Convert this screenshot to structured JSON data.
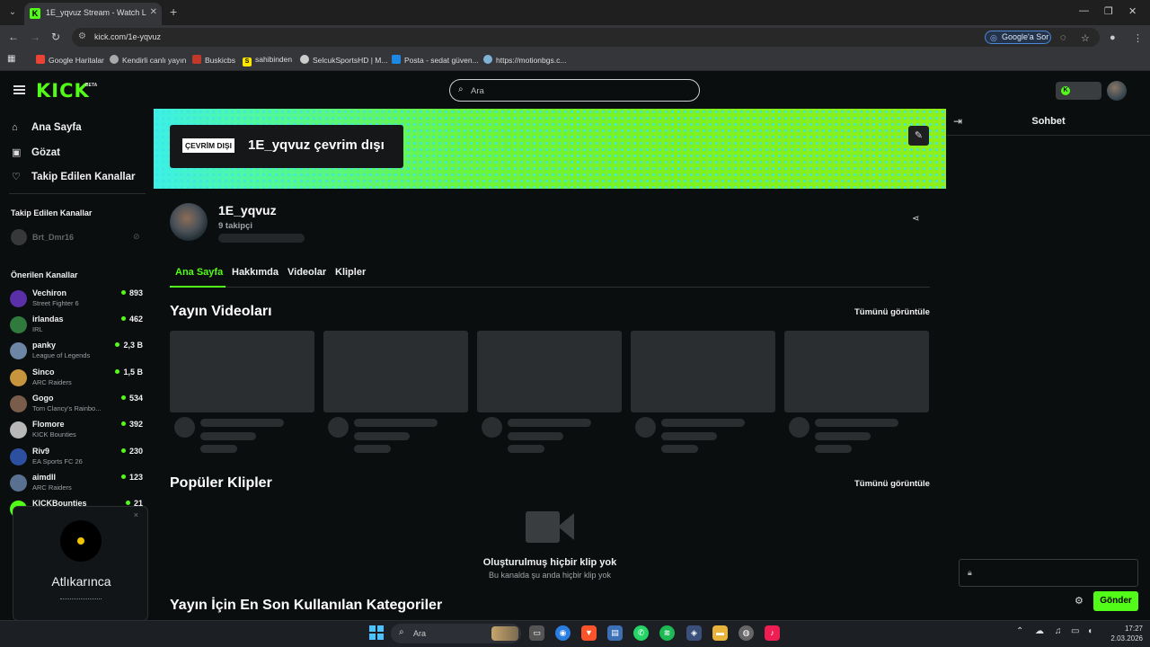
{
  "browser": {
    "tab_title": "1E_yqvuz Stream - Watch Live o",
    "tab_favicon": "K",
    "url": "kick.com/1e-yqvuz",
    "google_sor": "Google'a Sor",
    "bookmarks": [
      "Google Haritalar",
      "Kendirli canlı yayın",
      "Buskicbs",
      "sahibinden",
      "SelcukSportsHD | M...",
      "Posta - sedat güven...",
      "https://motionbgs.c..."
    ]
  },
  "topnav": {
    "logo": "KICK",
    "logo_beta": "BETA",
    "search_placeholder": "Ara",
    "badge_letter": "K"
  },
  "sidebar": {
    "nav": [
      {
        "label": "Ana Sayfa",
        "icon": "home-icon"
      },
      {
        "label": "Gözat",
        "icon": "browse-icon"
      },
      {
        "label": "Takip Edilen Kanallar",
        "icon": "heart-icon"
      }
    ],
    "followed_heading": "Takip Edilen Kanallar",
    "followed": [
      {
        "name": "Brt_Dmr16"
      }
    ],
    "recommended_heading": "Önerilen Kanallar",
    "recommended": [
      {
        "name": "Vechiron",
        "category": "Street Fighter 6",
        "viewers": "893",
        "color": "#5b2fa8"
      },
      {
        "name": "irlandas",
        "category": "IRL",
        "viewers": "462",
        "color": "#2f7a3c"
      },
      {
        "name": "panky",
        "category": "League of Legends",
        "viewers": "2,3 B",
        "color": "#6e86a6"
      },
      {
        "name": "Sinco",
        "category": "ARC Raiders",
        "viewers": "1,5 B",
        "color": "#c7953d"
      },
      {
        "name": "Gogo",
        "category": "Tom Clancy's Rainbo...",
        "viewers": "534",
        "color": "#7a5c4a"
      },
      {
        "name": "Flomore",
        "category": "KICK Bounties",
        "viewers": "392",
        "color": "#b8b8b8"
      },
      {
        "name": "Riv9",
        "category": "EA Sports FC 26",
        "viewers": "230",
        "color": "#2d4fa0"
      },
      {
        "name": "aimdll",
        "category": "ARC Raiders",
        "viewers": "123",
        "color": "#5a7090"
      },
      {
        "name": "KICKBounties",
        "category": "",
        "viewers": "21",
        "color": "#53fc18"
      }
    ]
  },
  "popup": {
    "title": "Atlıkarınca",
    "close": "×"
  },
  "banner": {
    "offline_tag": "ÇEVRİM DIŞI",
    "offline_text": "1E_yqvuz çevrim dışı"
  },
  "channel": {
    "name": "1E_yqvuz",
    "followers": "9 takipçi",
    "tabs": [
      "Ana Sayfa",
      "Hakkımda",
      "Videolar",
      "Klipler"
    ]
  },
  "sections": {
    "videos_heading": "Yayın Videoları",
    "see_all": "Tümünü görüntüle",
    "clips_heading": "Popüler Klipler",
    "clips_see_all": "Tümünü görüntüle",
    "no_clips_title": "Oluşturulmuş hiçbir klip yok",
    "no_clips_sub": "Bu kanalda şu anda hiçbir klip yok",
    "categories_heading": "Yayın İçin En Son Kullanılan Kategoriler"
  },
  "chat": {
    "title": "Sohbet",
    "send": "Gönder"
  },
  "taskbar": {
    "search": "Ara",
    "time": "17:27",
    "date": "2.03.2026"
  },
  "colors": {
    "accent": "#53fc18",
    "bg": "#0b0e0f"
  }
}
